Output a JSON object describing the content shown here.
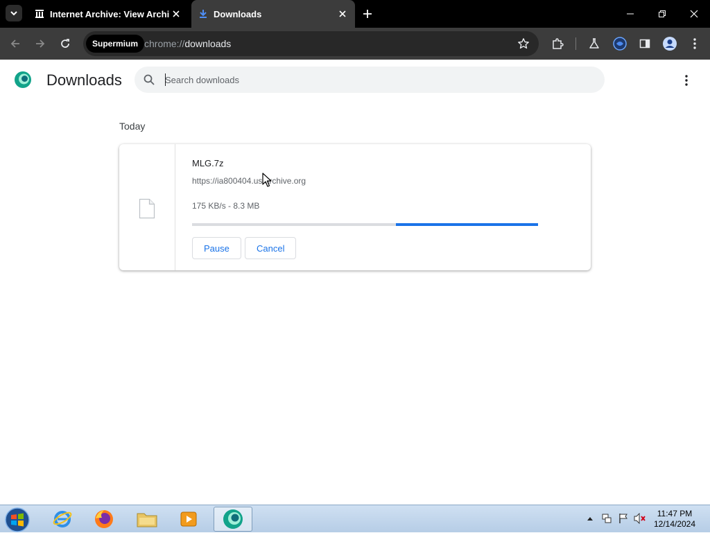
{
  "browser": {
    "tabs": [
      {
        "title": "Internet Archive: View Archive",
        "active": false
      },
      {
        "title": "Downloads",
        "active": true
      }
    ],
    "address": {
      "site_chip": "Supermium",
      "scheme": "chrome://",
      "host": "downloads"
    }
  },
  "downloads_page": {
    "title": "Downloads",
    "search_placeholder": "Search downloads",
    "section": "Today",
    "items": [
      {
        "file_name": "MLG.7z",
        "source_url": "https://ia800404.us.archive.org",
        "status": "175 KB/s - 8.3 MB",
        "progress_percent": 41,
        "buttons": {
          "pause": "Pause",
          "cancel": "Cancel"
        }
      }
    ]
  },
  "taskbar": {
    "apps": [
      "start-orb",
      "internet-explorer",
      "firefox",
      "file-explorer",
      "media-player",
      "supermium"
    ],
    "clock_time": "11:47 PM",
    "clock_date": "12/14/2024"
  },
  "colors": {
    "accent": "#1a73e8",
    "tabstrip": "#000000",
    "toolbar": "#3c3c3c"
  }
}
